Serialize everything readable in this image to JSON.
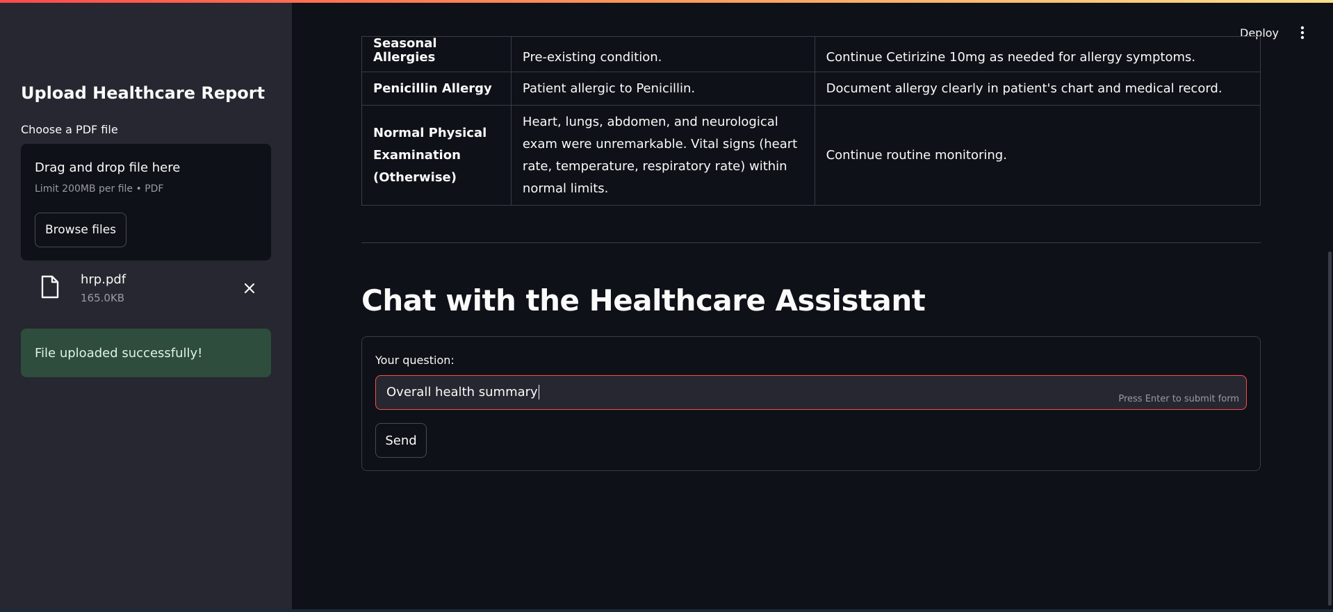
{
  "app": {
    "deploy_label": "Deploy"
  },
  "sidebar": {
    "title": "Upload Healthcare Report",
    "uploader": {
      "label": "Choose a PDF file",
      "drop_text": "Drag and drop file here",
      "limit_text": "Limit 200MB per file • PDF",
      "browse_label": "Browse files"
    },
    "file": {
      "name": "hrp.pdf",
      "size": "165.0KB",
      "icon": "file-icon",
      "remove_icon": "close-icon"
    },
    "success_message": "File uploaded successfully!"
  },
  "table": {
    "rows": [
      {
        "finding": "Seasonal Allergies",
        "details": "Pre-existing condition.",
        "recommendation": "Continue Cetirizine 10mg as needed for allergy symptoms."
      },
      {
        "finding": "Penicillin Allergy",
        "details": "Patient allergic to Penicillin.",
        "recommendation": "Document allergy clearly in patient's chart and medical record."
      },
      {
        "finding": "Normal Physical Examination (Otherwise)",
        "details": "Heart, lungs, abdomen, and neurological exam were unremarkable. Vital signs (heart rate, temperature, respiratory rate) within normal limits.",
        "recommendation": "Continue routine monitoring."
      }
    ]
  },
  "chat": {
    "title": "Chat with the Healthcare Assistant",
    "question_label": "Your question:",
    "question_value": "Overall health summary",
    "hint": "Press Enter to submit form",
    "send_label": "Send"
  },
  "colors": {
    "background": "#0e1117",
    "sidebar": "#262730",
    "accent": "#ff4b4b",
    "success_bg": "#2e4d3d"
  }
}
